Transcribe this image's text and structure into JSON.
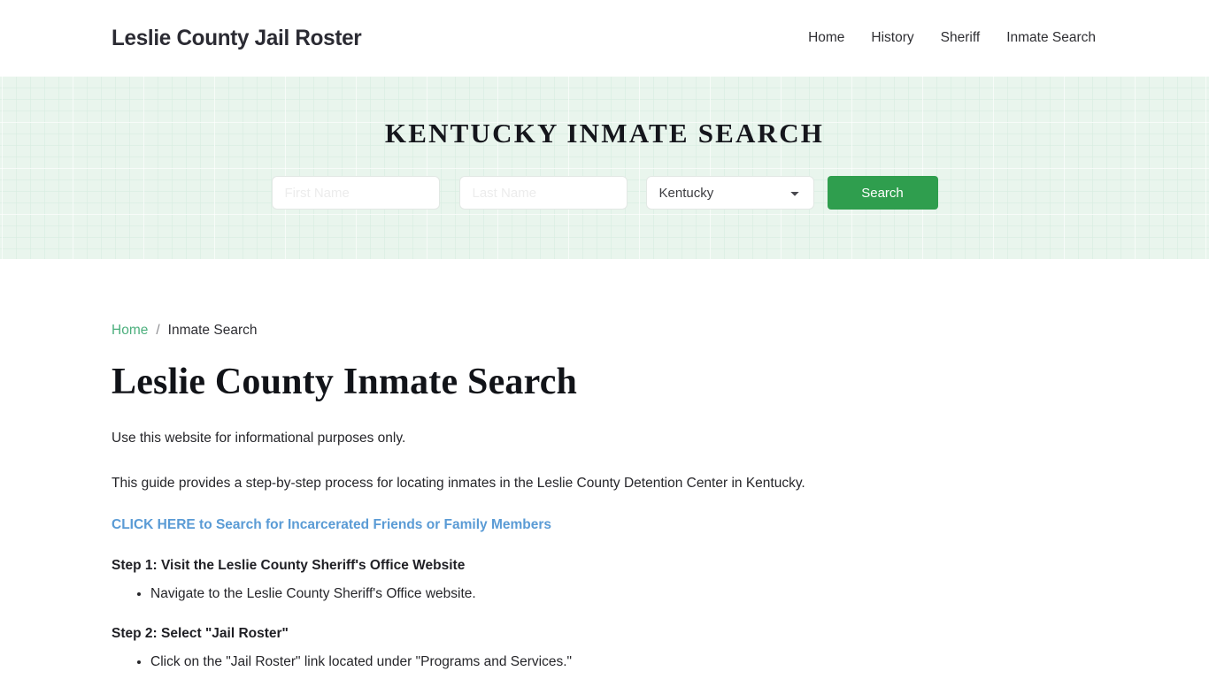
{
  "header": {
    "brand": "Leslie County Jail Roster",
    "nav": [
      {
        "label": "Home"
      },
      {
        "label": "History"
      },
      {
        "label": "Sheriff"
      },
      {
        "label": "Inmate Search"
      }
    ]
  },
  "hero": {
    "title": "KENTUCKY INMATE SEARCH",
    "first_name_placeholder": "First Name",
    "first_name_value": "",
    "last_name_placeholder": "Last Name",
    "last_name_value": "",
    "state_selected": "Kentucky",
    "state_options": [
      "Kentucky"
    ],
    "search_button": "Search",
    "accent_color": "#2f9e4e",
    "background_color": "#e9f5ed"
  },
  "breadcrumb": {
    "home": "Home",
    "separator": "/",
    "current": "Inmate Search"
  },
  "main": {
    "title": "Leslie County Inmate Search",
    "paragraph1": "Use this website for informational purposes only.",
    "paragraph2": "This guide provides a step-by-step process for locating inmates in the Leslie County Detention Center in Kentucky.",
    "cta_link": "CLICK HERE to Search for Incarcerated Friends or Family Members",
    "cta_color": "#5a9bd5",
    "steps": [
      {
        "heading": "Step 1: Visit the Leslie County Sheriff's Office Website",
        "items": [
          "Navigate to the Leslie County Sheriff's Office website."
        ]
      },
      {
        "heading": "Step 2: Select \"Jail Roster\"",
        "items": [
          "Click on the \"Jail Roster\" link located under \"Programs and Services.\""
        ]
      }
    ]
  }
}
